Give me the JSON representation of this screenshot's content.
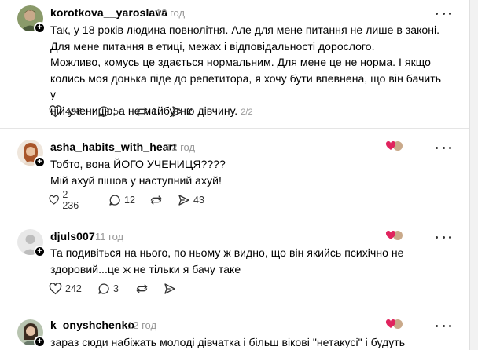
{
  "posts": [
    {
      "username": "korotkova__yaroslava",
      "time": "12 год",
      "lines": [
        "Так, у 18 років людина повнолітня. Але для мене питання не лише в законі.",
        "Для мене питання в етиці, межах і відповідальності дорослого.",
        "Можливо, комусь це здається нормальним. Для мене це не норма. І якщо",
        "колись моя донька піде до репетитора, я хочу бути впевнена, що він бачить у",
        "ній ученицю, а не майбутню дівчину."
      ],
      "pager": "2/2",
      "likes": "498",
      "replies": "5",
      "reposts": "1",
      "shares": "2"
    },
    {
      "username": "asha_habits_with_heart",
      "time": "12 год",
      "lines": [
        "Тобто, вона ЙОГО УЧЕНИЦЯ????",
        "Мій ахуй пішов у наступний ахуй!"
      ],
      "likes": "2 236",
      "replies": "12",
      "shares": "43"
    },
    {
      "username": "djuls007",
      "time": "11 год",
      "lines": [
        "Та подивіться на нього, по ньому ж видно, що він якийсь психічно не",
        "здоровий...це ж не тільки я бачу таке"
      ],
      "likes": "242",
      "replies": "3"
    },
    {
      "username": "k_onyshchenko",
      "time": "12 год",
      "lines": [
        "зараз сюди набіжать молоді дівчатка і більш вікові \"нетакусі\" і будуть"
      ]
    }
  ],
  "colors": {
    "heart_red": "#e0245e",
    "muted": "#999999"
  }
}
